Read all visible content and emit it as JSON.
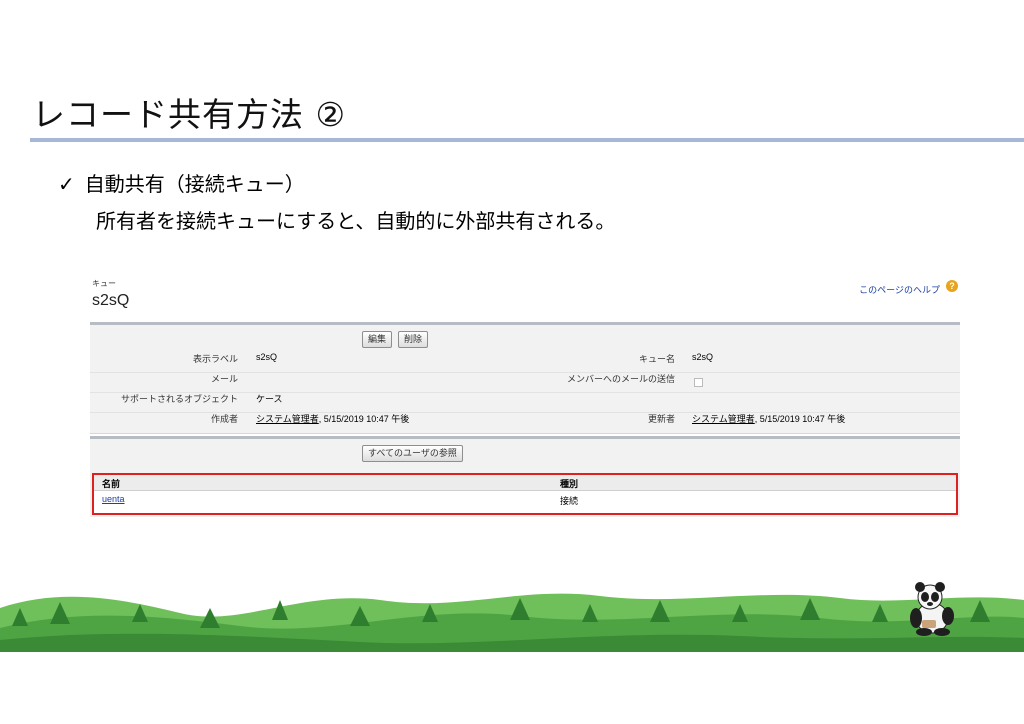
{
  "slide": {
    "title": "レコード共有方法 ②",
    "bullet": "自動共有（接続キュー）",
    "sub": "所有者を接続キューにすると、自動的に外部共有される。"
  },
  "queue": {
    "type_label": "キュー",
    "name": "s2sQ",
    "help_link": "このページのヘルプ",
    "buttons": {
      "edit": "編集",
      "delete": "削除"
    },
    "fields": {
      "display_label": {
        "label": "表示ラベル",
        "value": "s2sQ"
      },
      "queue_name": {
        "label": "キュー名",
        "value": "s2sQ"
      },
      "email": {
        "label": "メール",
        "value": ""
      },
      "send_email": {
        "label": "メンバーへのメールの送信",
        "checked": false
      },
      "objects": {
        "label": "サポートされるオブジェクト",
        "value": "ケース"
      },
      "created_by": {
        "label": "作成者",
        "user": "システム管理者",
        "date": ", 5/15/2019 10:47 午後"
      },
      "modified_by": {
        "label": "更新者",
        "user": "システム管理者",
        "date": ", 5/15/2019 10:47 午後"
      }
    },
    "view_users_button": "すべてのユーザの参照",
    "members": {
      "headers": [
        "名前",
        "種別"
      ],
      "rows": [
        {
          "name": "uenta",
          "type": "接続"
        }
      ]
    }
  },
  "colors": {
    "highlight": "#e0201f",
    "title_rule": "#a8b7d8"
  }
}
